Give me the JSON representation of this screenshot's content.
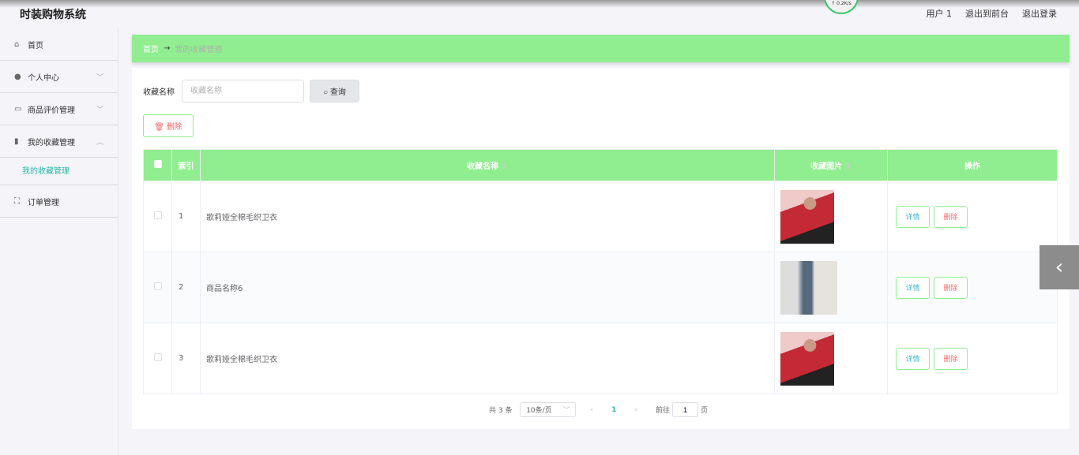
{
  "header": {
    "title": "时装购物系统",
    "user": "用户 1",
    "to_front": "退出到前台",
    "logout": "退出登录",
    "net_speed": "↑ 0.2K/s"
  },
  "sidebar": {
    "items": [
      {
        "label": "首页",
        "icon": "home-icon"
      },
      {
        "label": "个人中心",
        "icon": "user-icon"
      },
      {
        "label": "商品评价管理",
        "icon": "comment-icon"
      },
      {
        "label": "我的收藏管理",
        "icon": "clipboard-icon"
      },
      {
        "label": "订单管理",
        "icon": "order-icon"
      }
    ],
    "sub_item": "我的收藏管理"
  },
  "breadcrumb": {
    "home": "首页",
    "arrow": "→",
    "current": "我的收藏管理"
  },
  "search": {
    "label": "收藏名称",
    "placeholder": "收藏名称",
    "button": "查询"
  },
  "toolbar": {
    "delete": "删除"
  },
  "table": {
    "headers": {
      "index": "索引",
      "name": "收藏名称",
      "image": "收藏图片",
      "ops": "操作"
    },
    "rows": [
      {
        "index": "1",
        "name": "歌莉娅全棉毛织卫衣"
      },
      {
        "index": "2",
        "name": "商品名称6"
      },
      {
        "index": "3",
        "name": "歌莉娅全棉毛织卫衣"
      }
    ],
    "detail": "详情",
    "delete": "删除"
  },
  "pagination": {
    "total": "共 3 条",
    "page_size": "10条/页",
    "current": "1",
    "goto_label": "前往",
    "goto_value": "1",
    "page_suffix": "页"
  },
  "colors": {
    "accent": "#90ee90",
    "teal": "#2bb8a7",
    "danger": "#f56c6c"
  }
}
